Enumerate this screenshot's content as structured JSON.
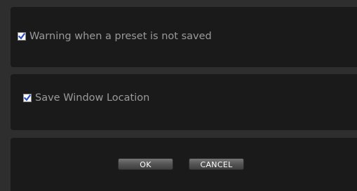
{
  "options": {
    "warning_unsaved_preset": {
      "label": "Warning when a preset is not saved",
      "checked": true
    },
    "save_window_location": {
      "label": "Save Window Location",
      "checked": true
    }
  },
  "buttons": {
    "ok_label": "OK",
    "cancel_label": "CANCEL"
  },
  "colors": {
    "background": "#2e2e2e",
    "panel": "#1a1a1a",
    "label_text": "#9a9a9a",
    "checkmark": "#2a4cc7"
  }
}
